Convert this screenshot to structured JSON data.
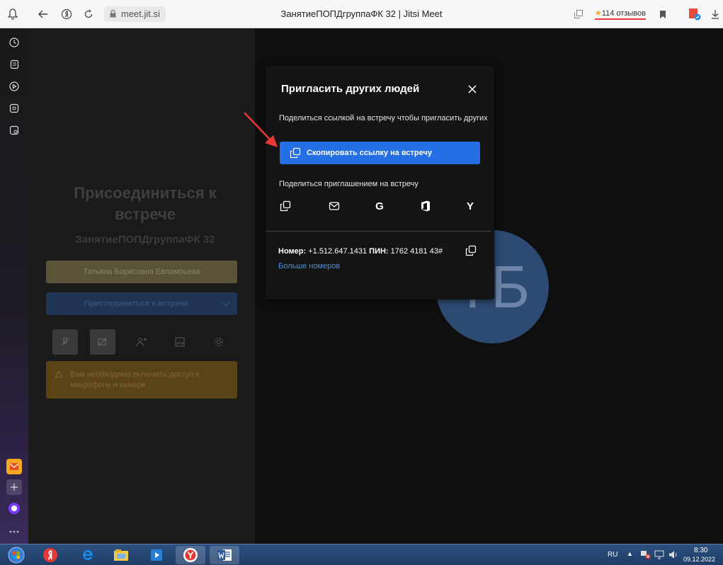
{
  "browser": {
    "address": "meet.jit.si",
    "page_title": "ЗанятиеПОПДгруппаФК 32 | Jitsi Meet",
    "reviews": "114 отзывов"
  },
  "join": {
    "title_line1": "Присоединиться к",
    "title_line2": "встрече",
    "room_name": "ЗанятиеПОПДгруппаФК 32",
    "name_value": "Татьяна Борисовна Евлампьева",
    "join_button": "Присоединиться к встрече",
    "warning": "Вам необходимо включить доступ к микрофону и камере"
  },
  "avatar": {
    "initials": "ТБ"
  },
  "dialog": {
    "title": "Пригласить других людей",
    "share_link_text": "Поделиться ссылкой на встречу чтобы пригласить других",
    "copy_button": "Скопировать ссылку на встречу",
    "share_invite_text": "Поделиться приглашением на встречу",
    "share_icons": [
      "copy-icon",
      "email-icon",
      "google-icon",
      "office-icon",
      "yahoo-icon"
    ],
    "share_letters": {
      "google": "G",
      "yahoo": "Y"
    },
    "phone_label": "Номер:",
    "phone_number": "+1.512.647.1431",
    "pin_label": "ПИН:",
    "pin_value": "1762 4181 43#",
    "more_numbers": "Больше номеров"
  },
  "taskbar": {
    "lang": "RU",
    "time": "8:30",
    "date": "09.12.2022"
  },
  "colors": {
    "accent": "#246fe5",
    "link": "#4a90e2",
    "arrow": "#e53935"
  }
}
